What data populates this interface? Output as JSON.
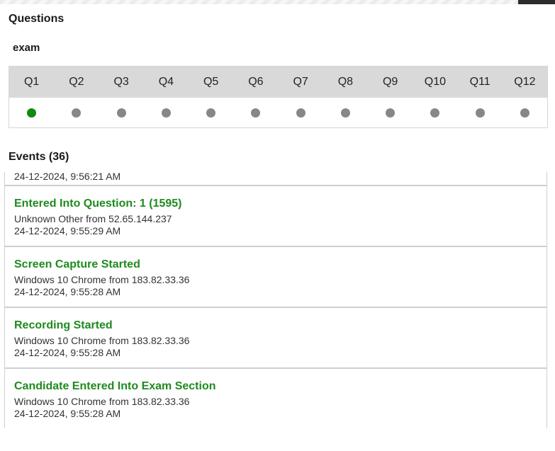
{
  "questions_title": "Questions",
  "section_name": "exam",
  "questions": [
    {
      "label": "Q1",
      "status": "answered"
    },
    {
      "label": "Q2",
      "status": "unanswered"
    },
    {
      "label": "Q3",
      "status": "unanswered"
    },
    {
      "label": "Q4",
      "status": "unanswered"
    },
    {
      "label": "Q5",
      "status": "unanswered"
    },
    {
      "label": "Q6",
      "status": "unanswered"
    },
    {
      "label": "Q7",
      "status": "unanswered"
    },
    {
      "label": "Q8",
      "status": "unanswered"
    },
    {
      "label": "Q9",
      "status": "unanswered"
    },
    {
      "label": "Q10",
      "status": "unanswered"
    },
    {
      "label": "Q11",
      "status": "unanswered"
    },
    {
      "label": "Q12",
      "status": "unanswered"
    }
  ],
  "colors": {
    "answered": "#0f8a0f",
    "unanswered": "#878787",
    "event_title": "#1f8a1f"
  },
  "events_title": "Events (36)",
  "events": [
    {
      "title": "",
      "detail": "",
      "time": "24-12-2024, 9:56:21 AM"
    },
    {
      "title": "Entered Into Question: 1 (1595)",
      "detail": "Unknown Other from 52.65.144.237",
      "time": "24-12-2024, 9:55:29 AM"
    },
    {
      "title": "Screen Capture Started",
      "detail": "Windows 10 Chrome from 183.82.33.36",
      "time": "24-12-2024, 9:55:28 AM"
    },
    {
      "title": "Recording Started",
      "detail": "Windows 10 Chrome from 183.82.33.36",
      "time": "24-12-2024, 9:55:28 AM"
    },
    {
      "title": "Candidate Entered Into Exam Section",
      "detail": "Windows 10 Chrome from 183.82.33.36",
      "time": "24-12-2024, 9:55:28 AM"
    }
  ]
}
